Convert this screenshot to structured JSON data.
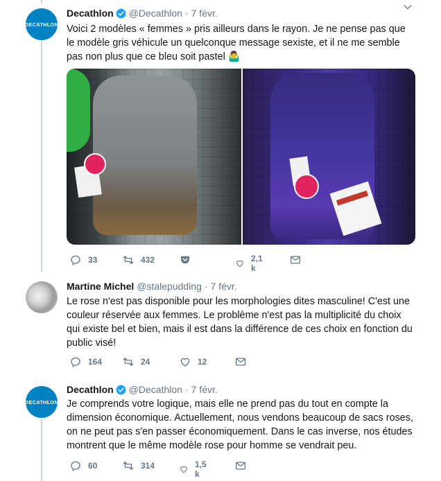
{
  "tweets": [
    {
      "avatar_text": "DECATHLON",
      "name": "Decathlon",
      "handle": "@Decathlon",
      "date": "7 févr.",
      "text": "Voici 2 modèles « femmes » pris ailleurs dans le rayon. Je ne pense pas que le modèle gris véhicule un quelconque message sexiste, et il ne me semble pas non plus que ce bleu soit pastel 🤷‍♂️",
      "replies": "33",
      "retweets": "432",
      "likes": "2,1 k"
    },
    {
      "name": "Martine Michel",
      "handle": "@stalepudding",
      "date": "7 févr.",
      "text": "Le rose n'est pas disponible pour les morphologies dites masculine! C'est une couleur réservée aux femmes. Le problème n'est pas la multiplicité du choix qui existe bel et bien, mais il est dans la différence de ces choix en fonction du public visé!",
      "replies": "164",
      "retweets": "24",
      "likes": "12"
    },
    {
      "avatar_text": "DECATHLON",
      "name": "Decathlon",
      "handle": "@Decathlon",
      "date": "7 févr.",
      "text": "Je comprends votre logique, mais elle ne prend pas du tout en compte la dimension économique. Actuellement, nous vendons beaucoup de sacs roses, on ne peut pas s'en passer économiquement. Dans le cas inverse, nos études montrent que le même modèle rose pour homme se vendrait peu.",
      "replies": "60",
      "retweets": "314",
      "likes": "1,5 k"
    }
  ],
  "colors": {
    "brand": "#0082c3",
    "verified": "#1da1f2",
    "muted": "#657786",
    "thread": "#ccd6dd"
  },
  "icons": [
    "verified-badge-icon",
    "caret-down-icon",
    "reply-icon",
    "retweet-icon",
    "heart-icon",
    "direct-message-icon",
    "pocket-save-icon"
  ]
}
